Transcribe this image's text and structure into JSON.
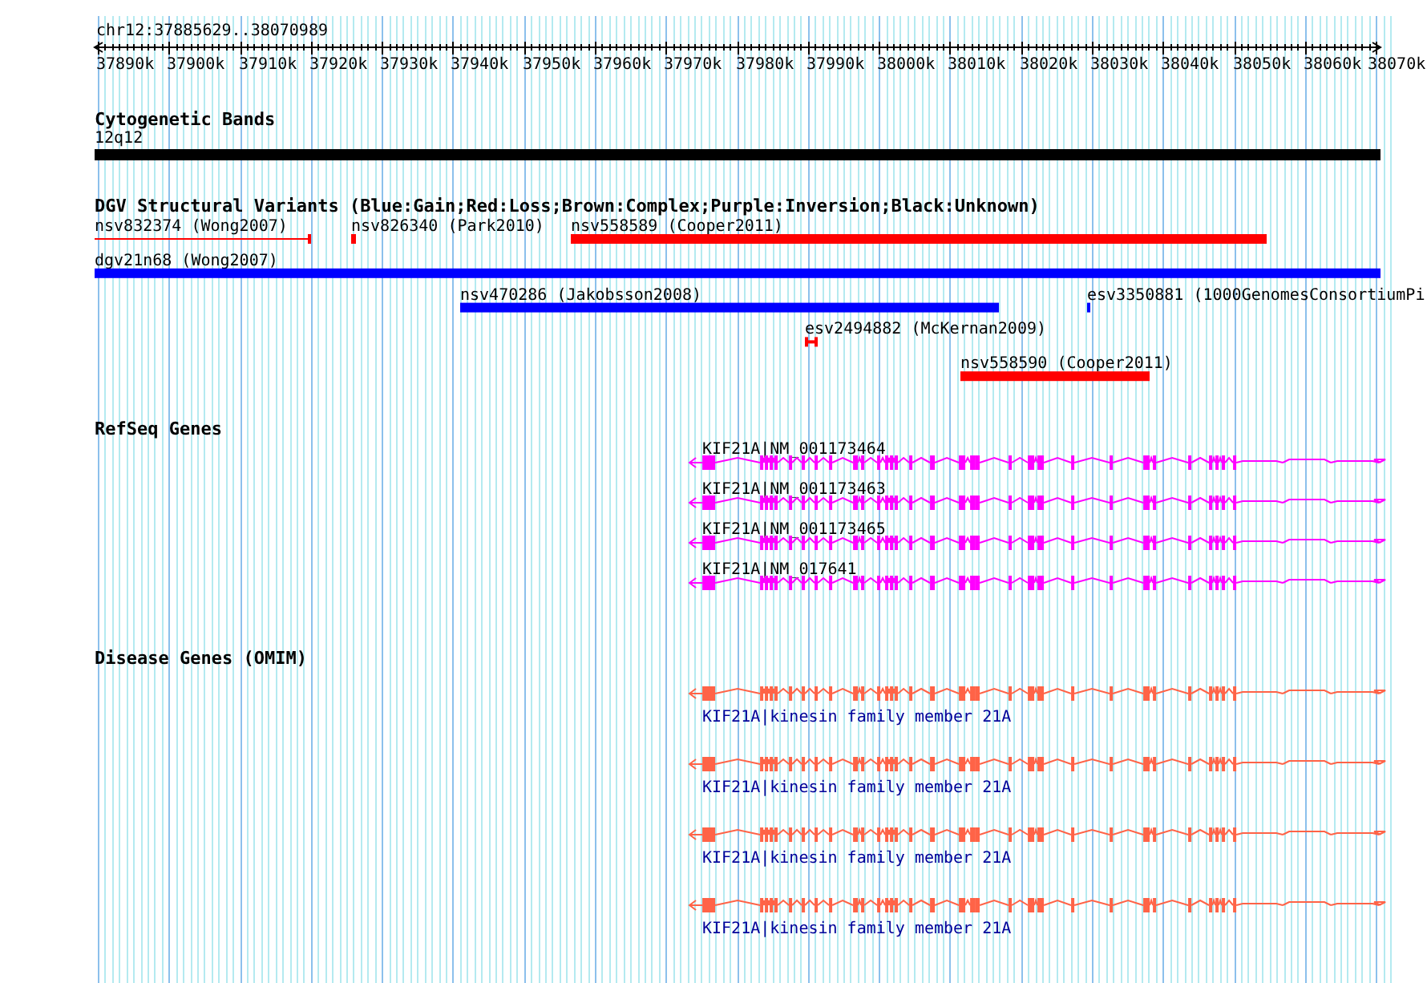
{
  "ruler": {
    "region": "chr12:37885629..38070989",
    "ticks": [
      "37890k",
      "37900k",
      "37910k",
      "37920k",
      "37930k",
      "37940k",
      "37950k",
      "37960k",
      "37970k",
      "37980k",
      "37990k",
      "38000k",
      "38010k",
      "38020k",
      "38030k",
      "38040k",
      "38050k",
      "38060k",
      "38070k"
    ]
  },
  "tracks": [
    {
      "kind": "bands",
      "title": "Cytogenetic Bands",
      "features": [
        {
          "label": "12q12",
          "color": "#000000"
        }
      ]
    },
    {
      "kind": "variants",
      "title": "DGV Structural Variants (Blue:Gain;Red:Loss;Brown:Complex;Purple:Inversion;Black:Unknown)",
      "rows": [
        {
          "features": [
            {
              "label": "nsv832374 (Wong2007)",
              "color": "#ff0000",
              "kind": "line"
            },
            {
              "label": "nsv826340 (Park2010)",
              "color": "#ff0000",
              "kind": "bar"
            },
            {
              "label": "nsv558589 (Cooper2011)",
              "color": "#ff0000",
              "kind": "bar"
            }
          ]
        },
        {
          "features": [
            {
              "label": "dgv21n68 (Wong2007)",
              "color": "#0000ff",
              "kind": "bar"
            }
          ]
        },
        {
          "features": [
            {
              "label": "nsv470286 (Jakobsson2008)",
              "color": "#0000ff",
              "kind": "bar"
            },
            {
              "label": "esv3350881 (1000GenomesConsortiumPi",
              "color": "#0000ff",
              "kind": "bar"
            }
          ]
        },
        {
          "features": [
            {
              "label": "esv2494882 (McKernan2009)",
              "color": "#ff0000",
              "kind": "span"
            }
          ]
        },
        {
          "features": [
            {
              "label": "nsv558590 (Cooper2011)",
              "color": "#ff0000",
              "kind": "bar"
            }
          ]
        }
      ]
    },
    {
      "kind": "transcripts",
      "title": "RefSeq Genes",
      "color": "#ff00ff",
      "features": [
        {
          "label": "KIF21A|NM_001173464"
        },
        {
          "label": "KIF21A|NM_001173463"
        },
        {
          "label": "KIF21A|NM_001173465"
        },
        {
          "label": "KIF21A|NM_017641"
        }
      ]
    },
    {
      "kind": "disease_genes",
      "title": "Disease Genes (OMIM)",
      "color": "#ff6347",
      "features": [
        {
          "label": "KIF21A|kinesin family member 21A"
        },
        {
          "label": "KIF21A|kinesin family member 21A"
        },
        {
          "label": "KIF21A|kinesin family member 21A"
        },
        {
          "label": "KIF21A|kinesin family member 21A"
        }
      ]
    }
  ]
}
